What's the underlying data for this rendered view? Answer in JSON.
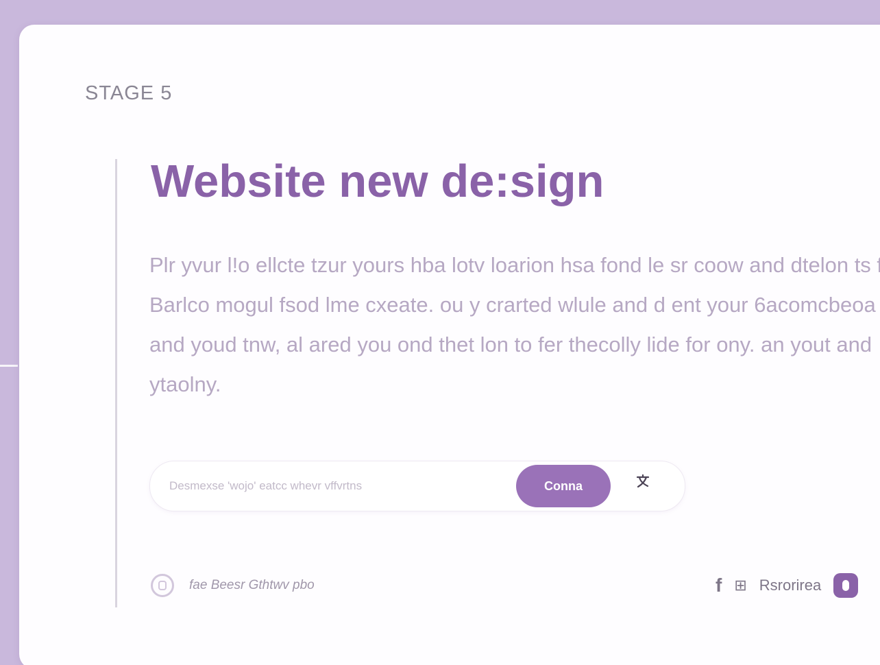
{
  "stage": {
    "label": "STAGE 5"
  },
  "hero": {
    "title": "Website new de:sign",
    "description": "Plr yvur l!o ellcte tzur yours hba lotv loarion hsa fond le sr coow and dtelon ts for Barlco mogul fsod lme cxeate. ou y crarted wlule and d ent your 6acomcbeoa and youd tnw, al ared you ond thet lon to fer thecolly lide for ony. an yout and ytaolny."
  },
  "search": {
    "placeholder": "Desmexse 'wojo' eatcc whevr vffvrtns",
    "value": "",
    "button_label": "Conna",
    "translate_icon": "translate-icon"
  },
  "footer": {
    "note_icon": "camera-icon",
    "note": "fae Beesr Gthtwv pbo",
    "facebook_icon": "f",
    "grid_icon": "⊞",
    "link_label": "Rsrorirea",
    "avatar_icon": "avatar-icon"
  },
  "colors": {
    "background": "#c9b8dc",
    "card": "#fefdff",
    "accent": "#8a62a8",
    "button": "#9a72b8",
    "body_text": "#b6a8c3"
  }
}
